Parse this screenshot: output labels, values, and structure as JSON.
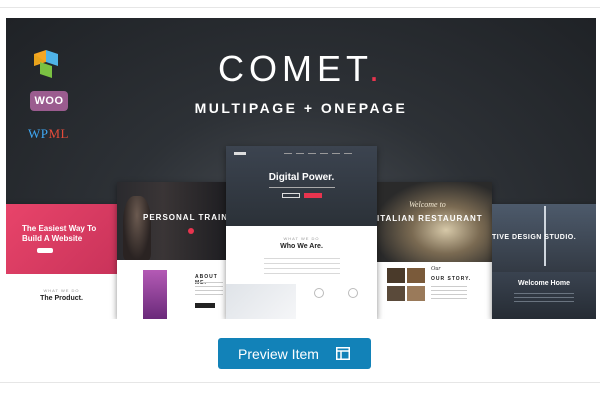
{
  "banner": {
    "title": "COMET",
    "title_dot": ".",
    "subtitle": "MULTIPAGE + ONEPAGE",
    "logos": {
      "woo": "WOO",
      "wpml_wp": "WP",
      "wpml_ml": "ML"
    }
  },
  "screens": {
    "pink": {
      "hero_text": "The Easiest Way To Build A Website",
      "kicker": "WHAT WE DO",
      "title": "The Product."
    },
    "trainer": {
      "hero_text": "PERSONAL TRAIN",
      "about": "ABOUT ME."
    },
    "digital": {
      "hero_title": "Digital Power.",
      "kicker": "WHAT WE DO",
      "title": "Who We Are."
    },
    "restaurant": {
      "welcome": "Welcome to",
      "hero_text": "ITALIAN RESTAURANT",
      "script": "Our",
      "story": "OUR STORY."
    },
    "studio": {
      "hero_text": "TIVE DESIGN STUDIO.",
      "welcome": "Welcome Home"
    }
  },
  "actions": {
    "preview_label": "Preview Item"
  },
  "colors": {
    "accent": "#e8344e",
    "button": "#1282b8",
    "banner_bg": "#2d3136"
  },
  "icons": {
    "preview": "layout-icon",
    "vc": "visual-composer-icon"
  }
}
